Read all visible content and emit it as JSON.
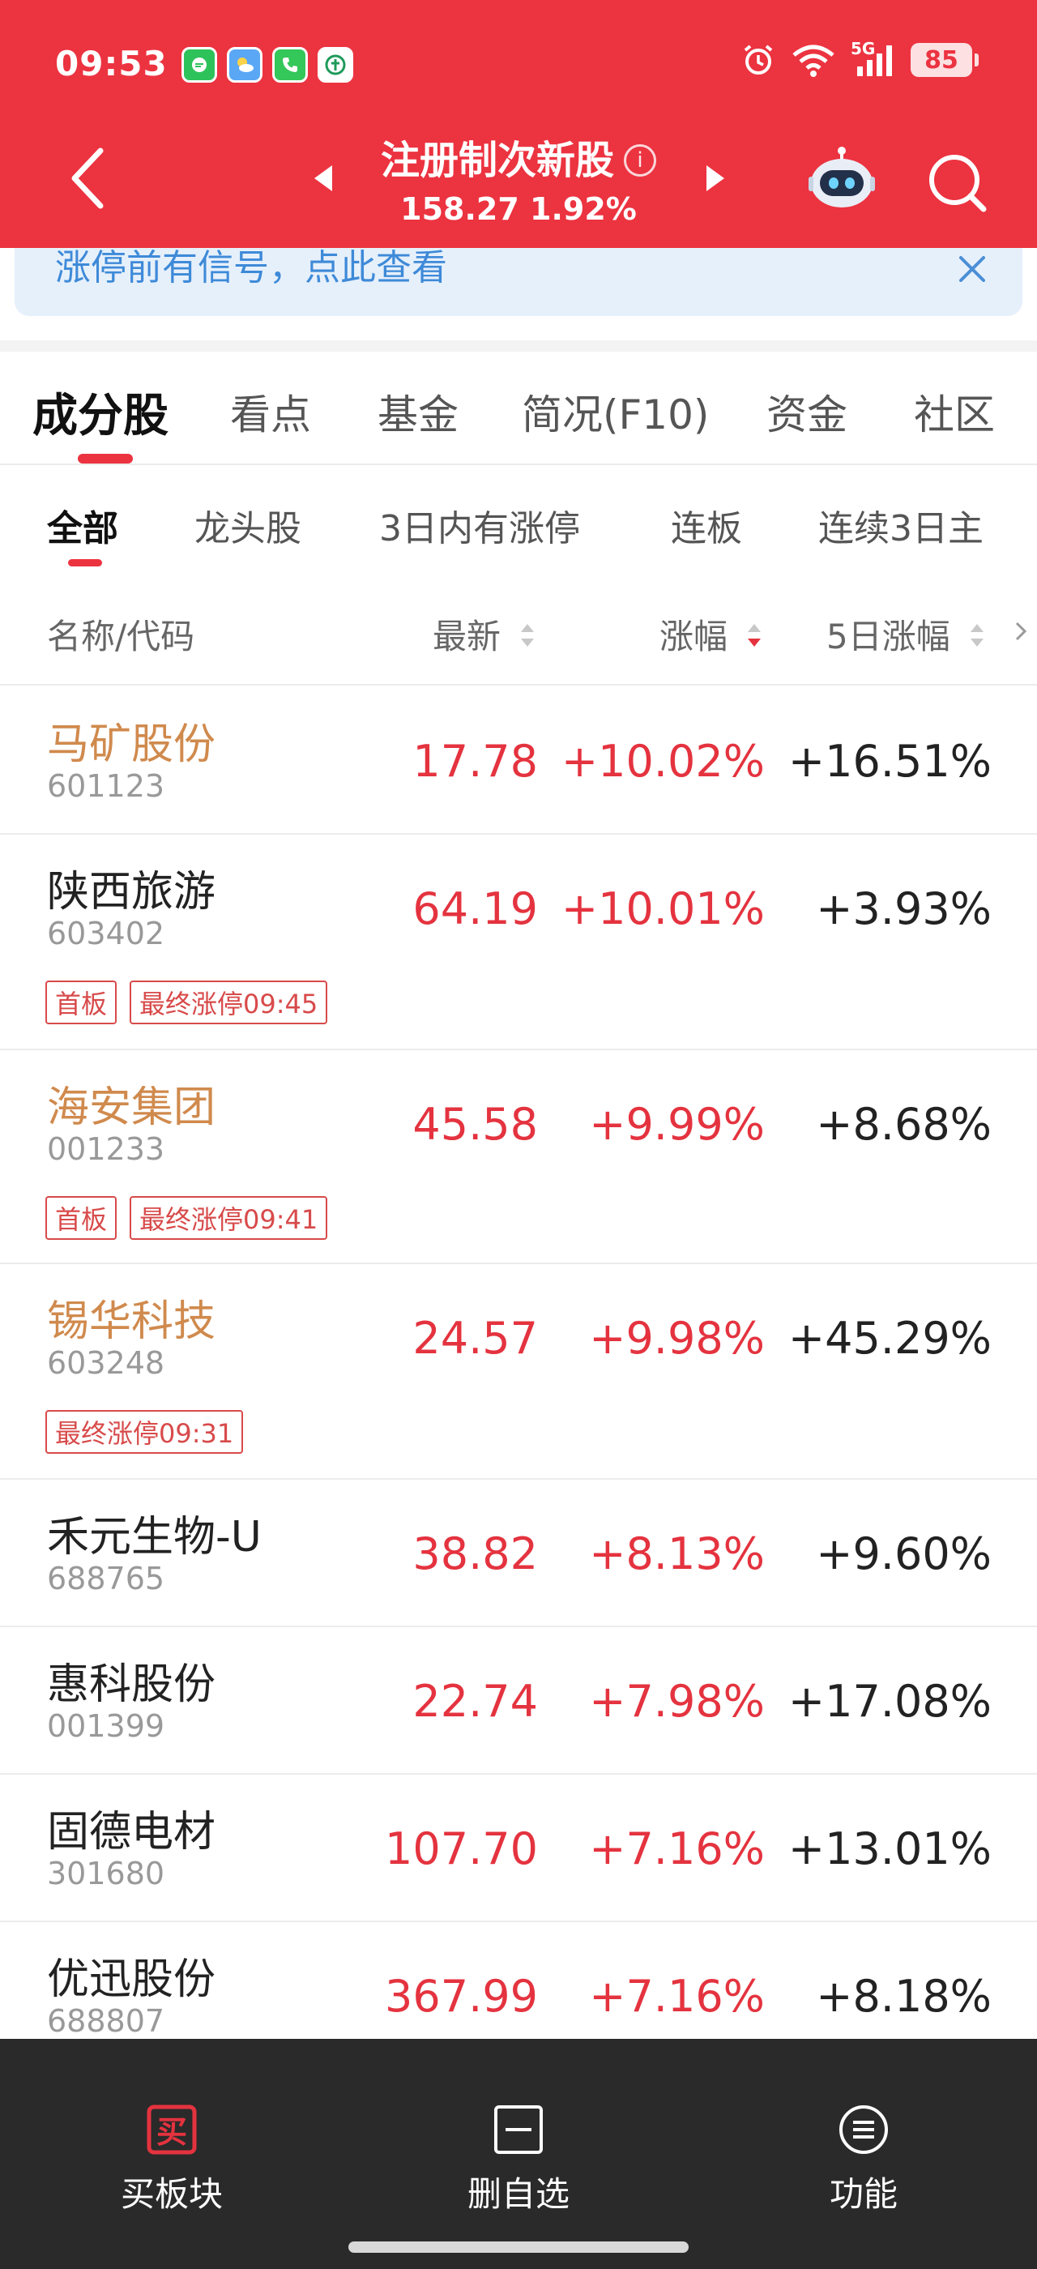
{
  "status_bar": {
    "time": "09:53",
    "battery": "85",
    "network": "5G"
  },
  "header": {
    "title": "注册制次新股",
    "index_value": "158.27",
    "index_change": "1.92%",
    "info_glyph": "i"
  },
  "notice": {
    "text": "涨停前有信号，点此查看"
  },
  "main_tabs": [
    {
      "label": "成分股",
      "active": true
    },
    {
      "label": "看点"
    },
    {
      "label": "基金"
    },
    {
      "label": "简况(F10)"
    },
    {
      "label": "资金"
    },
    {
      "label": "社区"
    }
  ],
  "sub_tabs": [
    {
      "label": "全部",
      "active": true
    },
    {
      "label": "龙头股"
    },
    {
      "label": "3日内有涨停"
    },
    {
      "label": "连板"
    },
    {
      "label": "连续3日主"
    }
  ],
  "columns": {
    "name": "名称/代码",
    "latest": "最新",
    "change": "涨幅",
    "change_5d": "5日涨幅"
  },
  "stocks": [
    {
      "name": "马矿股份",
      "code": "601123",
      "price": "17.78",
      "change": "+10.02%",
      "change5": "+16.51%",
      "highlight": true,
      "tags": []
    },
    {
      "name": "陕西旅游",
      "code": "603402",
      "price": "64.19",
      "change": "+10.01%",
      "change5": "+3.93%",
      "highlight": false,
      "tags": [
        "首板",
        "最终涨停09:45"
      ]
    },
    {
      "name": "海安集团",
      "code": "001233",
      "price": "45.58",
      "change": "+9.99%",
      "change5": "+8.68%",
      "highlight": true,
      "tags": [
        "首板",
        "最终涨停09:41"
      ]
    },
    {
      "name": "锡华科技",
      "code": "603248",
      "price": "24.57",
      "change": "+9.98%",
      "change5": "+45.29%",
      "highlight": true,
      "tags": [
        "最终涨停09:31"
      ]
    },
    {
      "name": "禾元生物-U",
      "code": "688765",
      "price": "38.82",
      "change": "+8.13%",
      "change5": "+9.60%",
      "highlight": false,
      "tags": []
    },
    {
      "name": "惠科股份",
      "code": "001399",
      "price": "22.74",
      "change": "+7.98%",
      "change5": "+17.08%",
      "highlight": false,
      "tags": []
    },
    {
      "name": "固德电材",
      "code": "301680",
      "price": "107.70",
      "change": "+7.16%",
      "change5": "+13.01%",
      "highlight": false,
      "tags": []
    },
    {
      "name": "优迅股份",
      "code": "688807",
      "price": "367.99",
      "change": "+7.16%",
      "change5": "+8.18%",
      "highlight": false,
      "tags": []
    }
  ],
  "toolbar": {
    "buy_icon_char": "买",
    "buy_label": "买板块",
    "remove_label": "删自选",
    "function_label": "功能"
  },
  "colors": {
    "brand_red": "#ec3340",
    "up_red": "#e4333f",
    "highlight_orange": "#d08a4d",
    "notice_blue": "#3e8ad8"
  }
}
